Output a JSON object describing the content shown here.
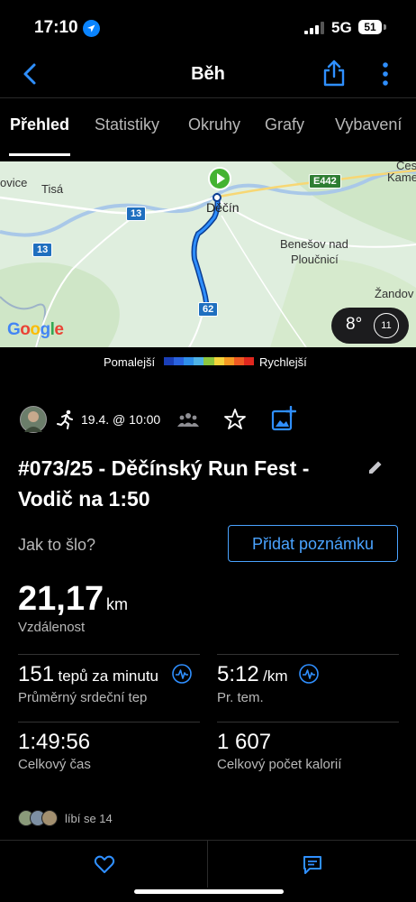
{
  "status": {
    "time": "17:10",
    "network": "5G",
    "battery": "51"
  },
  "header": {
    "title": "Běh"
  },
  "tabs": [
    "Přehled",
    "Statistiky",
    "Okruhy",
    "Grafy",
    "Vybavení"
  ],
  "map": {
    "places": {
      "vice": "ovice",
      "tisa": "Tisá",
      "decin": "Děčín",
      "benesov1": "Benešov nad",
      "benesov2": "Ploučnicí",
      "zandov": "Žandov",
      "ces": "Čes",
      "kame": "Kame"
    },
    "roads": {
      "r13a": "13",
      "r13b": "13",
      "r62": "62",
      "e442": "E442"
    },
    "google": "Google",
    "weather": {
      "temp": "8°",
      "wind": "11"
    }
  },
  "legend": {
    "slower": "Pomalejší",
    "faster": "Rychlejší",
    "colors": [
      "#1a3fb8",
      "#2a63e0",
      "#2f8fea",
      "#4fb3e6",
      "#8cc63f",
      "#f4d43c",
      "#f59a23",
      "#ef5a22",
      "#e0271e"
    ]
  },
  "activity": {
    "date": "19.4. @ 10:00",
    "title": "#073/25 - Děčínský Run Fest - Vodič na 1:50",
    "feeling": "Jak to šlo?",
    "add_note": "Přidat poznámku",
    "distance": {
      "value": "21,17",
      "unit": "km",
      "label": "Vzdálenost"
    },
    "stats": [
      {
        "value": "151",
        "unit": "tepů za minutu",
        "label": "Průměrný srdeční tep"
      },
      {
        "value": "5:12",
        "unit": "/km",
        "label": "Pr. tem."
      },
      {
        "value": "1:49:56",
        "unit": "",
        "label": "Celkový čas"
      },
      {
        "value": "1 607",
        "unit": "",
        "label": "Celkový počet kalorií"
      }
    ],
    "likes": "líbí se 14"
  }
}
